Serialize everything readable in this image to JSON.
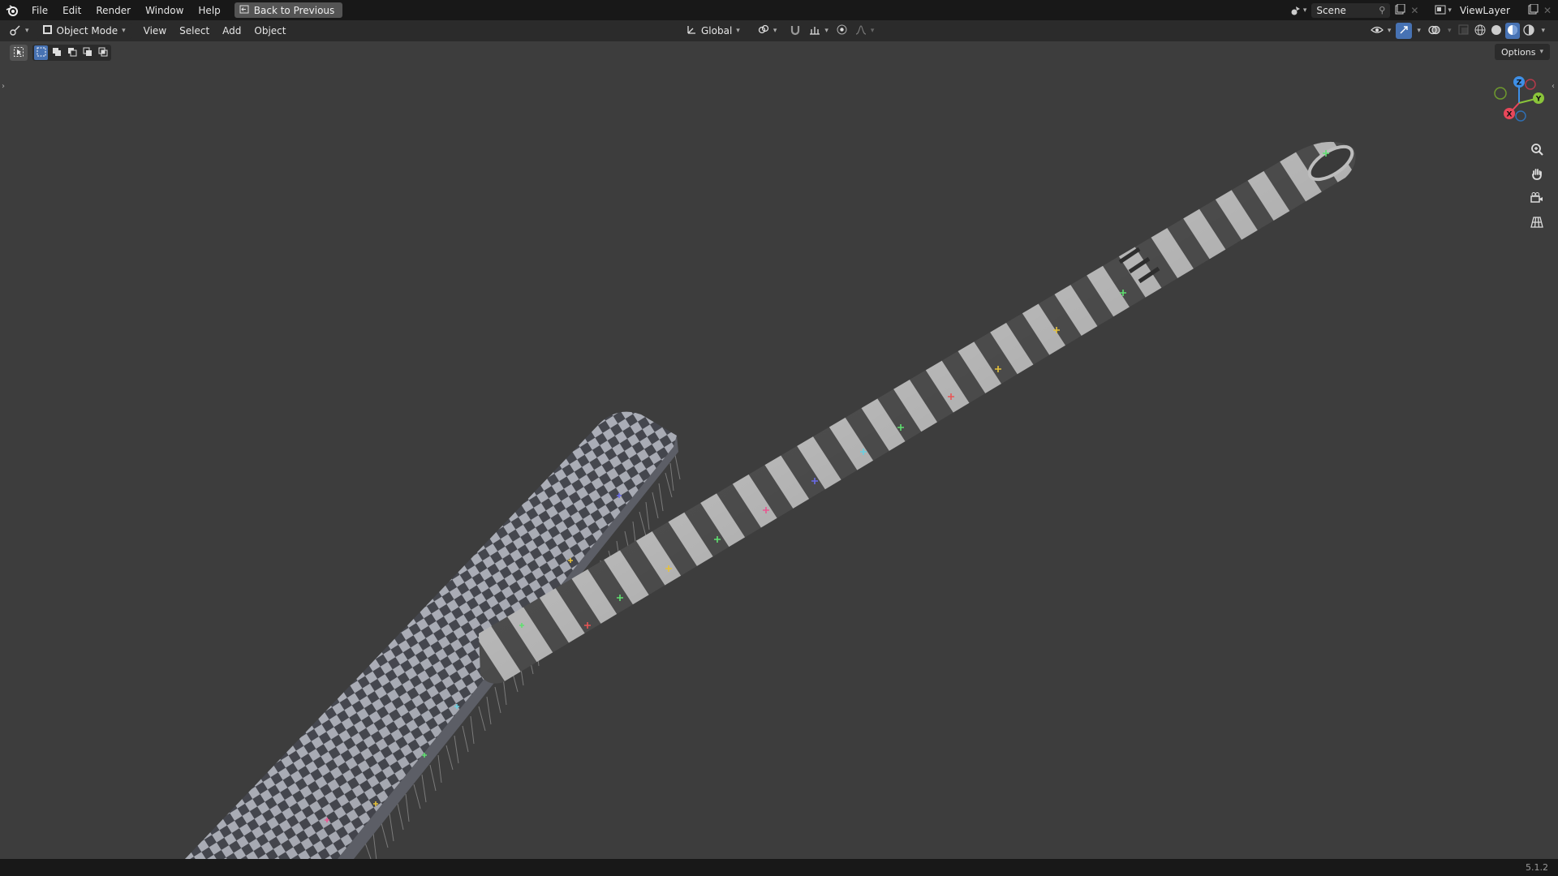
{
  "topbar": {
    "menu": [
      "File",
      "Edit",
      "Render",
      "Window",
      "Help"
    ],
    "back_label": "Back to Previous",
    "scene_label": "Scene",
    "viewlayer_label": "ViewLayer"
  },
  "toolbar": {
    "mode_label": "Object Mode",
    "menu": [
      "View",
      "Select",
      "Add",
      "Object"
    ],
    "transform_label": "Global"
  },
  "viewport": {
    "options_label": "Options",
    "gizmo": {
      "x": "X",
      "y": "Y",
      "z": "Z"
    },
    "colors": {
      "background": "#3d3d3d",
      "x_axis": "#e8475a",
      "y_axis": "#8ac43a",
      "z_axis": "#3e8fe6",
      "accent": "#4772b3"
    },
    "icons": [
      "zoom-icon",
      "hand-pan-icon",
      "camera-icon",
      "grid-perspective-icon"
    ]
  },
  "statusbar": {
    "version": "5.1.2"
  }
}
